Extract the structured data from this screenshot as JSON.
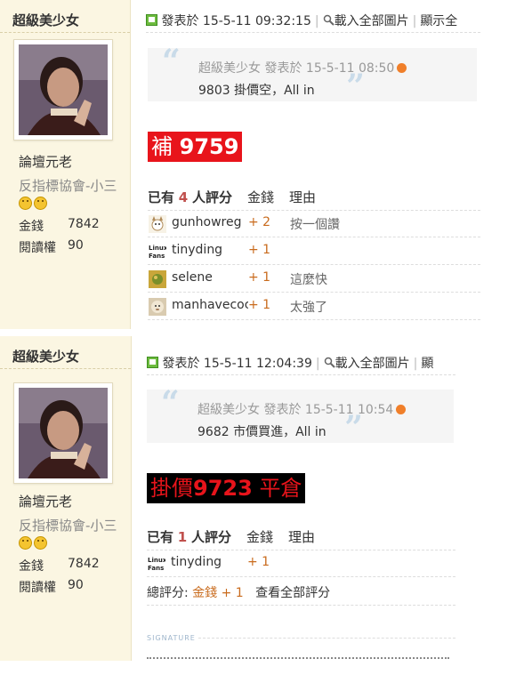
{
  "post1": {
    "author": "超級美少女",
    "user_title": "論壇元老",
    "user_group": "反指標協會-小三",
    "stats": [
      {
        "label": "金錢",
        "value": "7842"
      },
      {
        "label": "閱讀權",
        "value": "90"
      }
    ],
    "posted_label": "發表於",
    "posted_time": "15-5-11 09:32:15",
    "load_all_images": "載入全部圖片",
    "show_all": "顯示全",
    "quote": {
      "author": "超級美少女",
      "posted_label": "發表於",
      "time": "15-5-11 08:50",
      "body": "9803 掛價空，All in"
    },
    "headline_prefix": "補",
    "headline_value": "9759",
    "rating": {
      "prefix": "已有",
      "count": "4",
      "suffix": "人評分",
      "col_points": "金錢",
      "col_reason": "理由",
      "rows": [
        {
          "user": "gunhowreg",
          "points": "+ 2",
          "reason": "按一個讚",
          "icon": "cat-avatar-icon"
        },
        {
          "user": "tinyding",
          "points": "+ 1",
          "reason": "",
          "icon": "linux-fans-avatar-icon"
        },
        {
          "user": "selene",
          "points": "+ 1",
          "reason": "這麼快",
          "icon": "plant-avatar-icon"
        },
        {
          "user": "manhavecoc",
          "points": "+ 1",
          "reason": "太強了",
          "icon": "lion-avatar-icon"
        }
      ]
    }
  },
  "post2": {
    "author": "超級美少女",
    "user_title": "論壇元老",
    "user_group": "反指標協會-小三",
    "stats": [
      {
        "label": "金錢",
        "value": "7842"
      },
      {
        "label": "閱讀權",
        "value": "90"
      }
    ],
    "posted_label": "發表於",
    "posted_time": "15-5-11 12:04:39",
    "load_all_images": "載入全部圖片",
    "show_all": "顯",
    "quote": {
      "author": "超級美少女",
      "posted_label": "發表於",
      "time": "15-5-11 10:54",
      "body": "9682 市價買進，All in"
    },
    "headline_prefix": "掛價",
    "headline_value": "9723",
    "headline_suffix": "平倉",
    "rating": {
      "prefix": "已有",
      "count": "1",
      "suffix": "人評分",
      "col_points": "金錢",
      "col_reason": "理由",
      "rows": [
        {
          "user": "tinyding",
          "points": "+ 1",
          "reason": "",
          "icon": "linux-fans-avatar-icon"
        }
      ]
    },
    "summary": {
      "label": "總評分:",
      "points": "金錢 + 1",
      "view_all": "查看全部評分"
    },
    "signature_label": "SIGNATURE"
  },
  "colors": {
    "sidebar_bg": "#fbf6e2",
    "headline1_bg": "#e8141b",
    "headline2_bg": "#000000",
    "headline2_fg": "#e8141b",
    "points": "#c96b1d"
  }
}
